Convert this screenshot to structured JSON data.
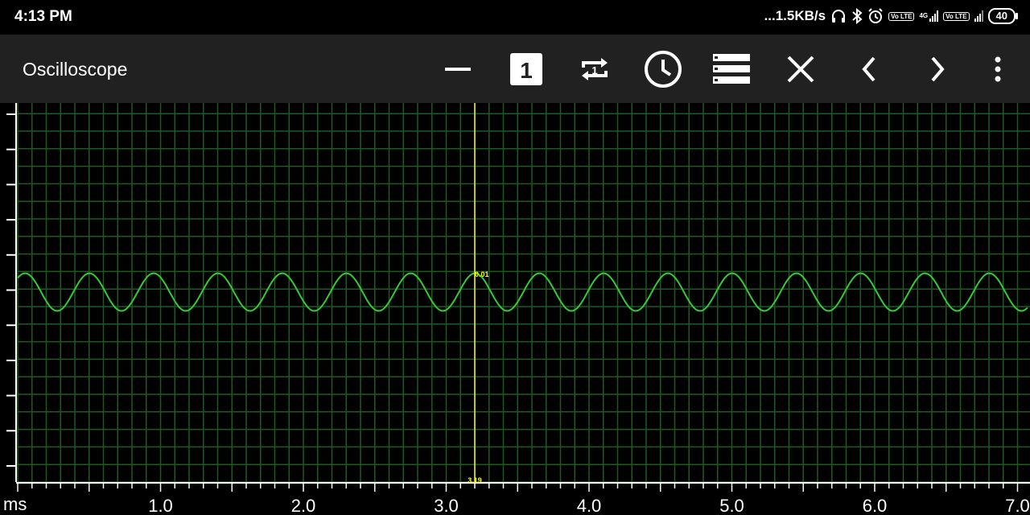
{
  "status": {
    "time": "4:13 PM",
    "net_speed": "...1.5KB/s",
    "sim1_label": "Vo LTE",
    "net_type": "4G",
    "sim2_label": "Vo LTE",
    "battery": "40"
  },
  "appbar": {
    "title": "Oscilloscope",
    "channel_badge": "1",
    "repeat_badge": "1"
  },
  "scope": {
    "x_unit": "ms",
    "x_ticks": [
      "1.0",
      "2.0",
      "3.0",
      "4.0",
      "5.0",
      "6.0",
      "7.0"
    ],
    "cursor_time_ms": 3.2,
    "cursor_value_label": "0.01",
    "cursor_bottom_label": "3.19",
    "colors": {
      "background": "#000000",
      "grid": "#1e5a1e",
      "trace": "#33cc33",
      "cursor": "#ffff00",
      "axis": "#ffffff"
    }
  },
  "chart_data": {
    "type": "line",
    "title": "",
    "xlabel": "ms",
    "ylabel": "",
    "xlim": [
      0.0,
      7.07
    ],
    "series": [
      {
        "waveform": "sine",
        "frequency_hz": 2222,
        "amplitude": 0.26,
        "offset": 0.0,
        "x_start": 0.0,
        "x_end": 7.07
      }
    ]
  }
}
